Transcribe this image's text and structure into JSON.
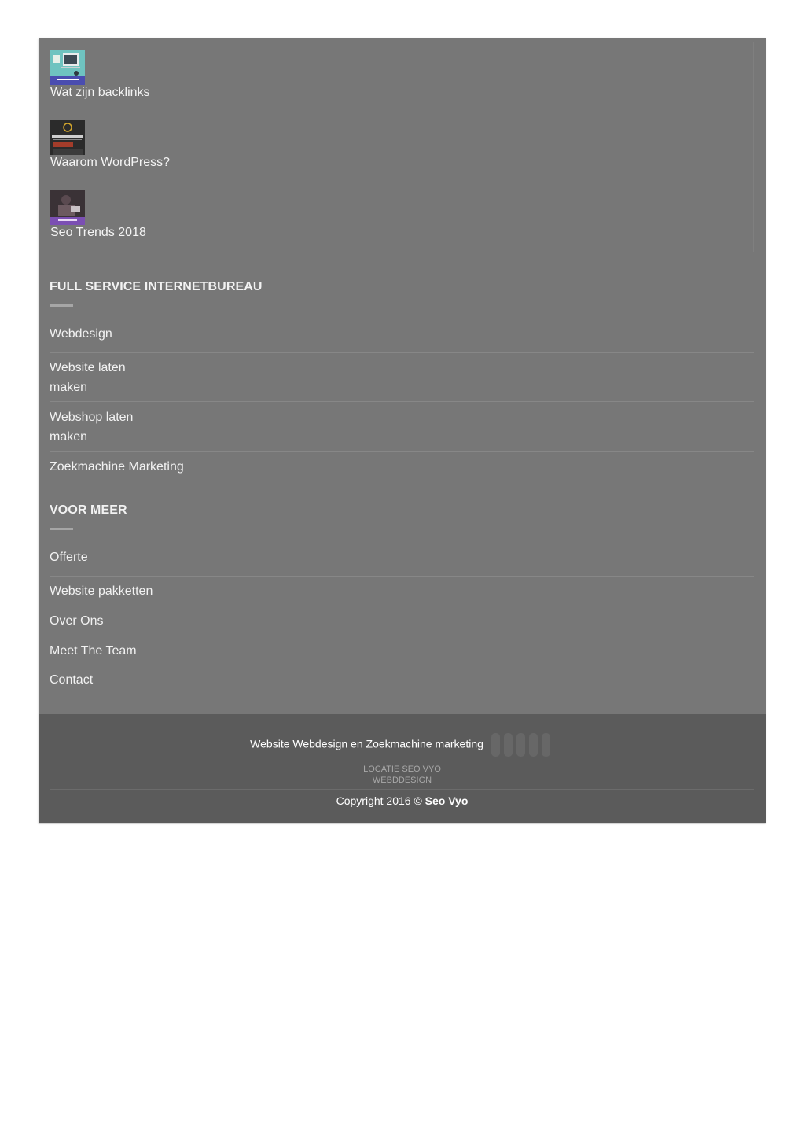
{
  "recent_posts": [
    {
      "title": "Wat zijn backlinks",
      "thumb_icon": "backlinks-thumbnail"
    },
    {
      "title": "Waarom WordPress?",
      "thumb_icon": "wordpress-thumbnail"
    },
    {
      "title": "Seo Trends 2018",
      "thumb_icon": "seo-trends-thumbnail"
    }
  ],
  "section_services": {
    "heading": "FULL SERVICE INTERNETBUREAU",
    "links": [
      {
        "line1": "Webdesign",
        "line2": ""
      },
      {
        "line1": "Website laten",
        "line2": "maken"
      },
      {
        "line1": "Webshop laten",
        "line2": "maken"
      },
      {
        "line1": "Zoekmachine Marketing",
        "line2": ""
      }
    ]
  },
  "section_more": {
    "heading": "VOOR MEER",
    "links": [
      "Offerte",
      "Website pakketten",
      "Over Ons",
      "Meet The Team",
      "Contact"
    ]
  },
  "footer": {
    "tagline": "Website Webdesign en Zoekmachine marketing",
    "location_line1": "LOCATIE SEO VYO",
    "location_line2": "WEBDDESIGN",
    "copyright_prefix": "Copyright 2016 ©",
    "copyright_brand": "Seo Vyo"
  },
  "colors": {
    "panel": "#777777",
    "footer": "#5b5b5b"
  }
}
